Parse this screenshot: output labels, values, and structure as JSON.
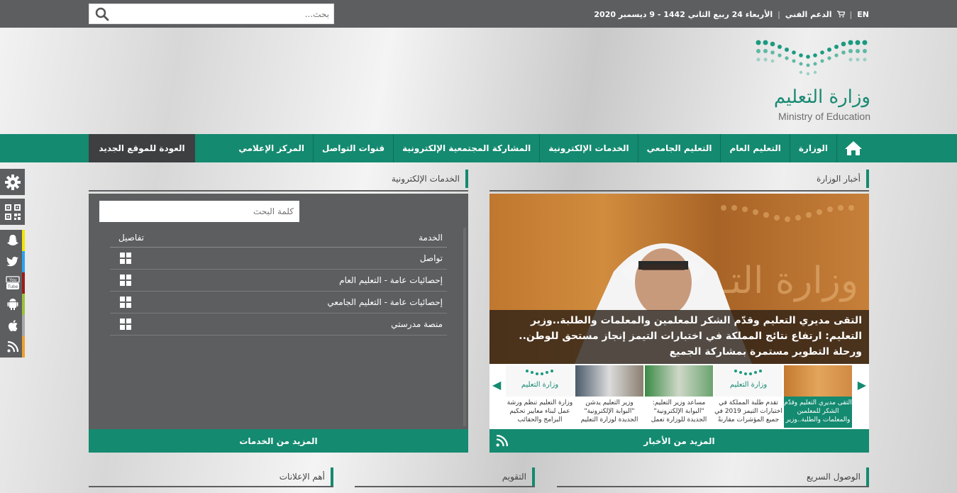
{
  "topbar": {
    "search_placeholder": "بحث...",
    "lang": "EN",
    "support": "الدعم الفني",
    "date": "الأربعاء 24 ربيع الثاني 1442 - 9 ديسمبر 2020"
  },
  "logo": {
    "arabic": "وزارة التعليم",
    "english": "Ministry of Education"
  },
  "nav": {
    "items": [
      "الوزارة",
      "التعليم العام",
      "التعليم الجامعي",
      "الخدمات الإلكترونية",
      "المشاركة المجتمعية الإلكترونية",
      "قنوات التواصل",
      "المركز الإعلامي"
    ],
    "back": "العودة للموقع الجديد"
  },
  "services": {
    "title": "الخدمات الإلكترونية",
    "search_placeholder": "كلمة البحث",
    "col_service": "الخدمة",
    "col_details": "تفاصيل",
    "rows": [
      "تواصل",
      "إحصائيات عامة - التعليم العام",
      "إحصائيات عامة - التعليم الجامعي",
      "منصة مدرستي"
    ],
    "more": "المزيد من الخدمات"
  },
  "news": {
    "title": "أخبار الوزارة",
    "headline": "التقى مديري التعليم وقدّم الشكر للمعلمين والمعلمات والطلبة..وزير التعليم: ارتفاع نتائج المملكة في اختبارات التيمز إنجاز مستحق للوطن.. ورحلة التطوير مستمرة بمشاركة الجميع",
    "thumbs": [
      "التقى مديري التعليم وقدّم الشكر للمعلمين والمعلمات والطلبة..وزير",
      "تقدم طلبة المملكة في اختبارات التيمز 2019 في جميع المؤشرات مقارنةً",
      "مساعد وزير التعليم: \"البوابة الإلكترونية\" الجديدة للوزارة تعمل",
      "وزير التعليم يدشن \"البوابة الإلكترونية\" الجديدة لوزارة التعليم",
      "وزارة التعليم تنظم ورشة عمل لبناء معايير تحكيم البرامج والحقائب"
    ],
    "more": "المزيد من الأخبار"
  },
  "bottom": {
    "quick": "الوصول السريع",
    "calendar": "التقويم",
    "ads": "أهم الإعلانات"
  },
  "colors": {
    "brand": "#148a70",
    "dark": "#5d5e60"
  }
}
